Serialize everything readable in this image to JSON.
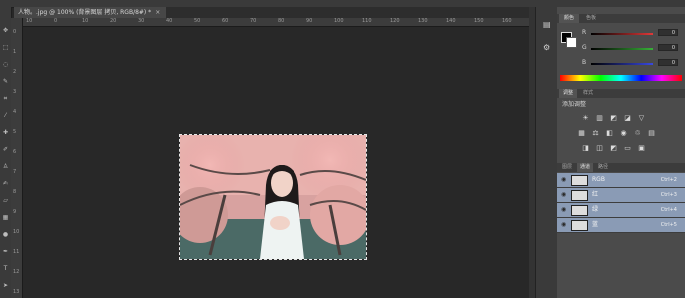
{
  "document": {
    "tab_title": "人物。.jpg @ 100% (背景图层 拷贝, RGB/8#) *",
    "close_glyph": "×"
  },
  "rulers": {
    "horizontal_ticks": [
      "10",
      "0",
      "10",
      "20",
      "30",
      "40",
      "50",
      "60",
      "70",
      "80",
      "90",
      "100",
      "110",
      "120",
      "130",
      "140",
      "150",
      "160"
    ],
    "vertical_ticks": [
      "0",
      "1",
      "2",
      "3",
      "4",
      "5",
      "6",
      "7",
      "8",
      "9",
      "10",
      "11",
      "12",
      "13"
    ]
  },
  "color_panel": {
    "tabs": [
      "颜色",
      "色板"
    ],
    "sliders": [
      {
        "label": "R",
        "value": "0",
        "color": "#e04040"
      },
      {
        "label": "G",
        "value": "0",
        "color": "#40b040"
      },
      {
        "label": "B",
        "value": "0",
        "color": "#4050e0"
      }
    ]
  },
  "adjustments_panel": {
    "tabs": [
      "调整",
      "样式"
    ],
    "heading": "添加调整",
    "row1_icons": [
      "brightness-icon",
      "levels-icon",
      "curves-icon",
      "exposure-icon",
      "vibrance-icon"
    ],
    "row2_icons": [
      "hue-saturation-icon",
      "color-balance-icon",
      "black-white-icon",
      "photo-filter-icon",
      "channel-mixer-icon",
      "color-lookup-icon"
    ],
    "row3_icons": [
      "invert-icon",
      "posterize-icon",
      "threshold-icon",
      "gradient-map-icon",
      "selective-color-icon"
    ]
  },
  "channels_panel": {
    "tabs": [
      "图层",
      "通道",
      "路径"
    ],
    "active_tab": "通道",
    "channels": [
      {
        "name": "RGB",
        "shortcut": "Ctrl+2"
      },
      {
        "name": "红",
        "shortcut": "Ctrl+3"
      },
      {
        "name": "绿",
        "shortcut": "Ctrl+4"
      },
      {
        "name": "蓝",
        "shortcut": "Ctrl+5"
      }
    ]
  }
}
